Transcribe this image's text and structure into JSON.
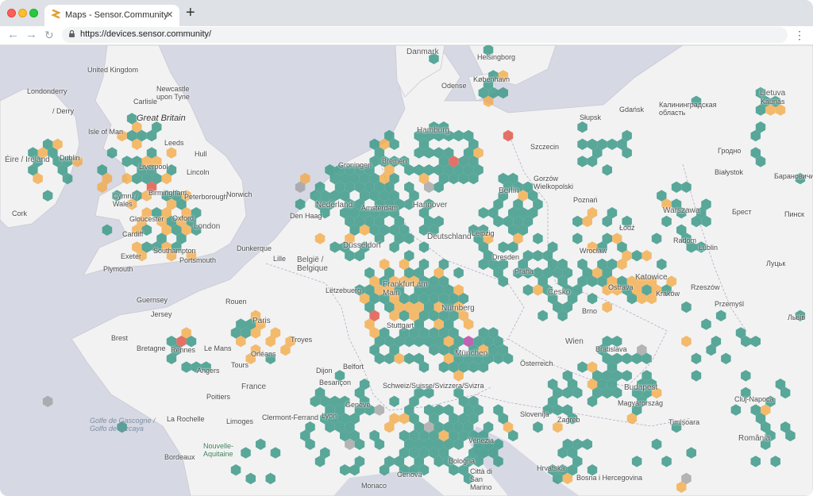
{
  "browser": {
    "tab_title": "Maps - Sensor.Community",
    "tab_close": "×",
    "new_tab": "+",
    "back": "←",
    "forward": "→",
    "reload": "↻",
    "url": "https://devices.sensor.community/",
    "menu": "⋮"
  },
  "colors": {
    "good": "#3d9a8a",
    "moderate": "#f3a73f",
    "high": "#e05a4e",
    "very_high": "#b64ba8",
    "offline": "#9a9a9a",
    "water": "#d6d8e4",
    "land": "#f2f2f2"
  },
  "map": {
    "labels": {
      "danmark": "Danmark",
      "united_kingdom": "United Kingdom",
      "newcastle": "Newcastle upon Tyne",
      "londonderry": "Londonderry",
      "derry": "/ Derry",
      "great_britain": "Great Britain",
      "carlisle": "Carlisle",
      "isle_of_man": "Isle of Man",
      "leeds": "Leeds",
      "hull": "Hull",
      "ireland": "Éire / Ireland",
      "dublin": "Dublin",
      "liverpool": "Liverpool",
      "lincoln": "Lincoln",
      "birmingham": "Birmingham",
      "peterborough": "Peterborough",
      "norwich": "Norwich",
      "wales": "Cymru / Wales",
      "cork": "Cork",
      "gloucester": "Gloucester",
      "oxford": "Oxford",
      "london": "London",
      "cardiff": "Cardiff",
      "southampton": "Southampton",
      "portsmouth": "Portsmouth",
      "exeter": "Exeter",
      "plymouth": "Plymouth",
      "dunkerque": "Dunkerque",
      "guernsey": "Guernsey",
      "jersey": "Jersey",
      "rouen": "Rouen",
      "paris": "Paris",
      "brest": "Brest",
      "rennes": "Rennes",
      "bretagne": "Bretagne",
      "le_mans": "Le Mans",
      "angers": "Angers",
      "tours": "Tours",
      "orleans": "Orléans",
      "troyes": "Troyes",
      "dijon": "Dijon",
      "france": "France",
      "poitiers": "Poitiers",
      "limoges": "Limoges",
      "clermont": "Clermont-Ferrand",
      "la_rochelle": "La Rochelle",
      "bordeaux": "Bordeaux",
      "nouvelle_aquitaine": "Nouvelle-Aquitaine",
      "golfe": "Golfe de Gascogne / Golfo de Vizcaya",
      "lyon": "Lyon",
      "belfort": "Belfort",
      "besancon": "Besançon",
      "geneve": "Genève",
      "monaco": "Monaco",
      "groningen": "Groningen",
      "nederland": "Nederland",
      "den_haag": "Den Haag",
      "amsterdam": "Amsterdam",
      "bremen": "Bremen",
      "hamburg": "Hamburg",
      "hannover": "Hannover",
      "deutschland": "Deutschland",
      "dusseldorf": "Düsseldorf",
      "belgique": "België / Belgique",
      "lille": "Lille",
      "letzebuerg": "Lëtzebuerg",
      "frankfurt": "Frankfurt am Main",
      "nurnberg": "Nürnberg",
      "stuttgart": "Stuttgart",
      "munchen": "München",
      "schweiz": "Schweiz/Suisse/Svizzera/Svizra",
      "berlin": "Berlin",
      "leipzig": "Leipzig",
      "dresden": "Dresden",
      "kobenhavn": "København",
      "odense": "Odense",
      "helsingborg": "Helsingborg",
      "gdansk": "Gdańsk",
      "slupsk": "Słupsk",
      "szczecin": "Szczecin",
      "gorzow": "Gorzów Wielkopolski",
      "poznan": "Poznań",
      "wroclaw": "Wrocław",
      "lodz": "Łódź",
      "warszawa": "Warszawa",
      "radom": "Radom",
      "katowice": "Katowice",
      "krakow": "Kraków",
      "ostrava": "Ostrava",
      "cesko": "Česko",
      "praha": "Praha",
      "brno": "Brno",
      "wien": "Wien",
      "osterreich": "Österreich",
      "bratislava": "Bratislava",
      "budapest": "Budapest",
      "magyarorszag": "Magyarország",
      "slovenija": "Slovenija",
      "zagreb": "Zagreb",
      "hrvatska": "Hrvatska",
      "bosna": "Bosna i Hercegovina",
      "venezia": "Venezia",
      "bologna": "Bologna",
      "genova": "Genova",
      "san_marino": "Città di San Marino",
      "timisoara": "Timișoara",
      "romania": "România",
      "cluj": "Cluj-Napoca",
      "lietuva": "Lietuva",
      "kaunas": "Kaunas",
      "grodno": "Гродно",
      "brest_by": "Брест",
      "lutsk": "Луцьк",
      "lublin": "Lublin",
      "rzeszow": "Rzeszów",
      "przemysl": "Przemyśl",
      "bialystok": "Białystok",
      "kaliningrad": "Калининградская область",
      "baranovichi": "Барановичи",
      "pinsk": "Пинск",
      "lviv": "Львів"
    },
    "hex_groups": {
      "uk": "uk",
      "benelux_de": "benelux_de",
      "france_west": "france_west",
      "alps": "alps",
      "poland_cz": "poland_cz",
      "hungary": "hungary",
      "balkan": "balkan"
    }
  }
}
